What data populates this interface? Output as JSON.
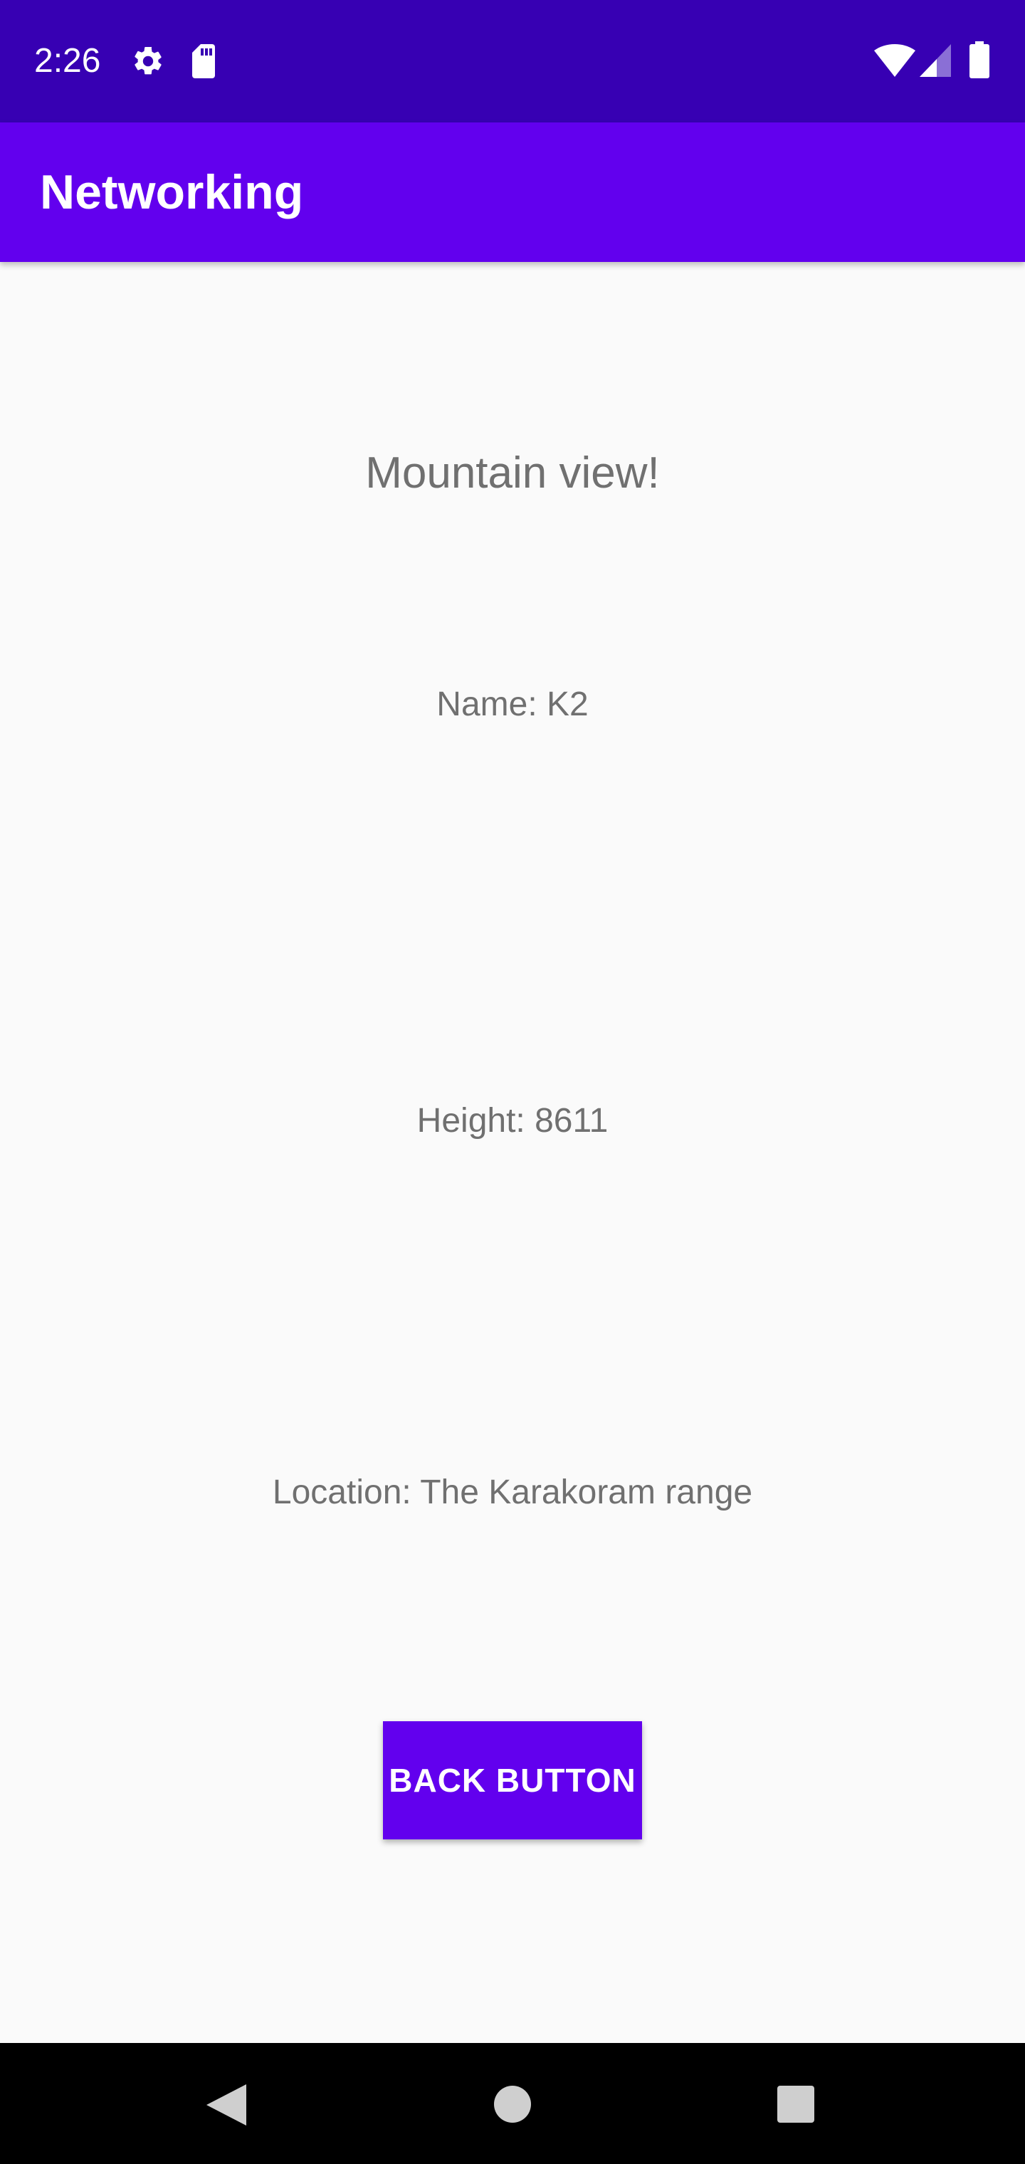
{
  "status_bar": {
    "time": "2:26",
    "icons": [
      "settings-icon",
      "sd-card-icon",
      "wifi-icon",
      "signal-icon",
      "battery-icon"
    ],
    "background": "#3700B3"
  },
  "app_bar": {
    "title": "Networking",
    "background": "#6200EE"
  },
  "content": {
    "heading": "Mountain view!",
    "name": "Name: K2",
    "height": "Height: 8611",
    "location": "Location: The Karakoram range",
    "text_color": "#707070"
  },
  "back_button": {
    "label": "BACK BUTTON",
    "background": "#6200EE"
  },
  "nav_bar": {
    "icons": [
      "back-nav-icon",
      "home-nav-icon",
      "recents-nav-icon"
    ],
    "background": "#000000"
  }
}
